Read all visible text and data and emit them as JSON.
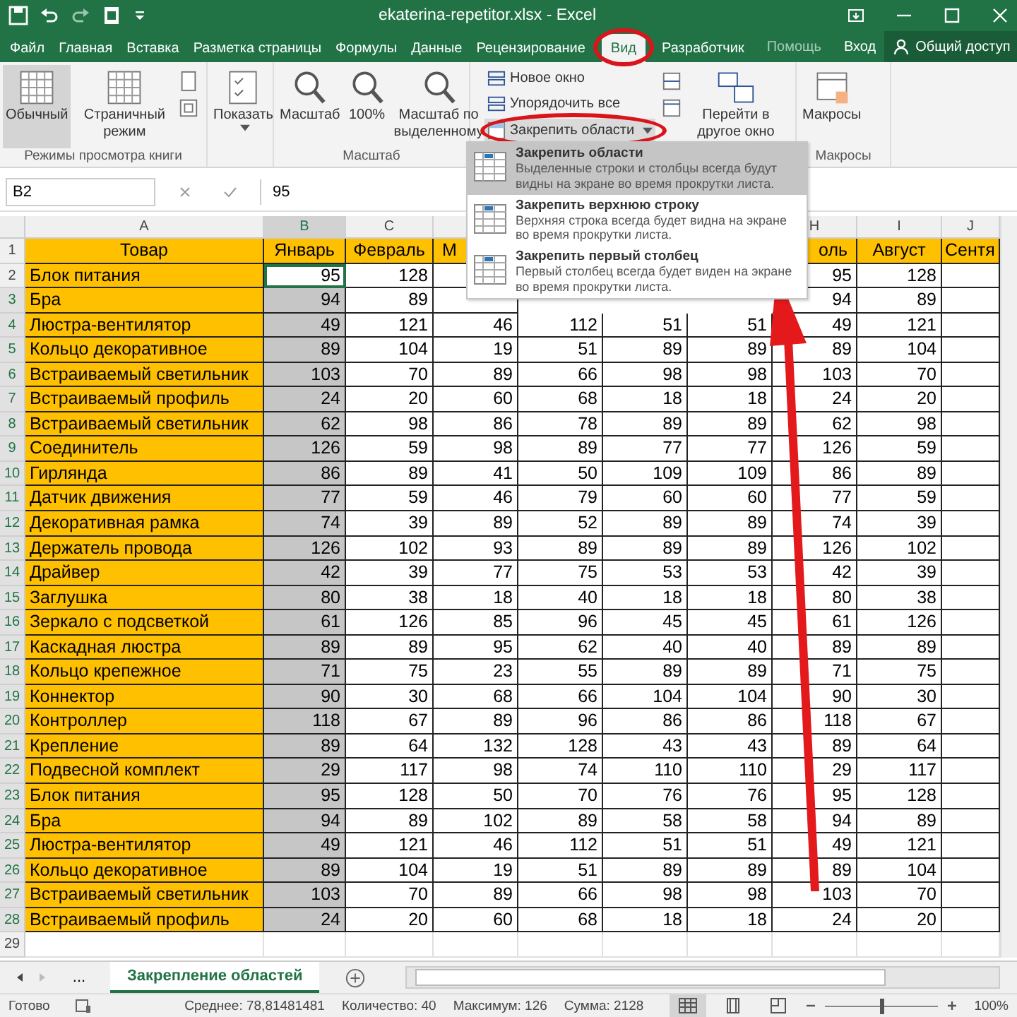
{
  "window": {
    "title": "ekaterina-repetitor.xlsx - Excel"
  },
  "tabs": [
    {
      "label": "Файл",
      "selected": false
    },
    {
      "label": "Главная",
      "selected": false
    },
    {
      "label": "Вставка",
      "selected": false
    },
    {
      "label": "Разметка страницы",
      "selected": false
    },
    {
      "label": "Формулы",
      "selected": false
    },
    {
      "label": "Данные",
      "selected": false
    },
    {
      "label": "Рецензирование",
      "selected": false
    },
    {
      "label": "Вид",
      "selected": true
    },
    {
      "label": "Разработчик",
      "selected": false
    }
  ],
  "help": "Помощь",
  "sign_in": "Вход",
  "share": "Общий доступ",
  "ribbon": {
    "views": {
      "label": "Режимы просмотра книги",
      "buttons": [
        {
          "label": "Обычный",
          "selected": true
        },
        {
          "label": "Страничный режим",
          "selected": false
        }
      ]
    },
    "show": "Показать",
    "zoom": {
      "label": "Масштаб",
      "buttons": [
        "Масштаб",
        "100%",
        "Масштаб по выделенному"
      ]
    },
    "window": {
      "commands": [
        "Новое окно",
        "Упорядочить все"
      ],
      "freeze": "Закрепить области",
      "switch": "Перейти в другое окно"
    },
    "macros": {
      "label": "Макросы",
      "button": "Макросы"
    }
  },
  "formula_bar": {
    "name_box": "B2",
    "value": "95"
  },
  "freeze_menu": [
    {
      "title": "Закрепить области",
      "description": "Выделенные строки и столбцы всегда будут видны на экране во время прокрутки листа.",
      "selected": true
    },
    {
      "title": "Закрепить верхнюю строку",
      "description": "Верхняя строка всегда будет видна на экране во время прокрутки листа.",
      "selected": false
    },
    {
      "title": "Закрепить первый столбец",
      "description": "Первый столбец всегда будет виден на экране во время прокрутки листа.",
      "selected": false
    }
  ],
  "sheet": {
    "column_letters": [
      "A",
      "B",
      "C",
      "H",
      "I",
      "J"
    ],
    "header_num": "1",
    "header": [
      "Товар",
      "Январь",
      "Февраль",
      "М",
      "оль",
      "Август",
      "Сентя"
    ],
    "rows": [
      {
        "num": "2",
        "label": "Блок питания",
        "selected": false,
        "values": [
          "95",
          "128",
          "95",
          "128"
        ]
      },
      {
        "num": "3",
        "label": "Бра",
        "selected": true,
        "values": [
          "94",
          "89",
          "94",
          "89"
        ]
      },
      {
        "num": "4",
        "label": "Люстра-вентилятор",
        "selected": true,
        "values": [
          "49",
          "121",
          "46",
          "112",
          "51",
          "51",
          "49",
          "121"
        ]
      },
      {
        "num": "5",
        "label": "Кольцо декоративное",
        "selected": true,
        "values": [
          "89",
          "104",
          "19",
          "51",
          "89",
          "89",
          "89",
          "104"
        ]
      },
      {
        "num": "6",
        "label": "Встраиваемый светильник",
        "selected": true,
        "values": [
          "103",
          "70",
          "89",
          "66",
          "98",
          "98",
          "103",
          "70"
        ]
      },
      {
        "num": "7",
        "label": "Встраиваемый профиль",
        "selected": true,
        "values": [
          "24",
          "20",
          "60",
          "68",
          "18",
          "18",
          "24",
          "20"
        ]
      },
      {
        "num": "8",
        "label": "Встраиваемый светильник",
        "selected": true,
        "values": [
          "62",
          "98",
          "86",
          "78",
          "89",
          "89",
          "62",
          "98"
        ]
      },
      {
        "num": "9",
        "label": "Соединитель",
        "selected": true,
        "values": [
          "126",
          "59",
          "98",
          "89",
          "77",
          "77",
          "126",
          "59"
        ]
      },
      {
        "num": "10",
        "label": "Гирлянда",
        "selected": true,
        "values": [
          "86",
          "89",
          "41",
          "50",
          "109",
          "109",
          "86",
          "89"
        ]
      },
      {
        "num": "11",
        "label": "Датчик движения",
        "selected": true,
        "values": [
          "77",
          "59",
          "46",
          "79",
          "60",
          "60",
          "77",
          "59"
        ]
      },
      {
        "num": "12",
        "label": "Декоративная рамка",
        "selected": true,
        "values": [
          "74",
          "39",
          "89",
          "52",
          "89",
          "89",
          "74",
          "39"
        ]
      },
      {
        "num": "13",
        "label": "Держатель провода",
        "selected": true,
        "values": [
          "126",
          "102",
          "93",
          "89",
          "89",
          "89",
          "126",
          "102"
        ]
      },
      {
        "num": "14",
        "label": "Драйвер",
        "selected": true,
        "values": [
          "42",
          "39",
          "77",
          "75",
          "53",
          "53",
          "42",
          "39"
        ]
      },
      {
        "num": "15",
        "label": "Заглушка",
        "selected": true,
        "values": [
          "80",
          "38",
          "18",
          "40",
          "18",
          "18",
          "80",
          "38"
        ]
      },
      {
        "num": "16",
        "label": "Зеркало с подсветкой",
        "selected": true,
        "values": [
          "61",
          "126",
          "85",
          "96",
          "45",
          "45",
          "61",
          "126"
        ]
      },
      {
        "num": "17",
        "label": "Каскадная люстра",
        "selected": true,
        "values": [
          "89",
          "89",
          "95",
          "62",
          "40",
          "40",
          "89",
          "89"
        ]
      },
      {
        "num": "18",
        "label": "Кольцо крепежное",
        "selected": true,
        "values": [
          "71",
          "75",
          "23",
          "55",
          "89",
          "89",
          "71",
          "75"
        ]
      },
      {
        "num": "19",
        "label": "Коннектор",
        "selected": true,
        "values": [
          "90",
          "30",
          "68",
          "66",
          "104",
          "104",
          "90",
          "30"
        ]
      },
      {
        "num": "20",
        "label": "Контроллер",
        "selected": true,
        "values": [
          "118",
          "67",
          "89",
          "96",
          "86",
          "86",
          "118",
          "67"
        ]
      },
      {
        "num": "21",
        "label": "Крепление",
        "selected": true,
        "values": [
          "89",
          "64",
          "132",
          "128",
          "43",
          "43",
          "89",
          "64"
        ]
      },
      {
        "num": "22",
        "label": "Подвесной комплект",
        "selected": true,
        "values": [
          "29",
          "117",
          "98",
          "74",
          "110",
          "110",
          "29",
          "117"
        ]
      },
      {
        "num": "23",
        "label": "Блок питания",
        "selected": true,
        "values": [
          "95",
          "128",
          "50",
          "70",
          "76",
          "76",
          "95",
          "128"
        ]
      },
      {
        "num": "24",
        "label": "Бра",
        "selected": true,
        "values": [
          "94",
          "89",
          "102",
          "89",
          "58",
          "58",
          "94",
          "89"
        ]
      },
      {
        "num": "25",
        "label": "Люстра-вентилятор",
        "selected": true,
        "values": [
          "49",
          "121",
          "46",
          "112",
          "51",
          "51",
          "49",
          "121"
        ]
      },
      {
        "num": "26",
        "label": "Кольцо декоративное",
        "selected": true,
        "values": [
          "89",
          "104",
          "19",
          "51",
          "89",
          "89",
          "89",
          "104"
        ]
      },
      {
        "num": "27",
        "label": "Встраиваемый светильник",
        "selected": true,
        "values": [
          "103",
          "70",
          "89",
          "66",
          "98",
          "98",
          "103",
          "70"
        ]
      },
      {
        "num": "28",
        "label": "Встраиваемый профиль",
        "selected": true,
        "values": [
          "24",
          "20",
          "60",
          "68",
          "18",
          "18",
          "24",
          "20"
        ]
      }
    ],
    "empty_rows": [
      {
        "num": "29"
      }
    ]
  },
  "sheet_tabs": {
    "more": "...",
    "tabs": [
      {
        "label": "Закрепление областей",
        "selected": true
      }
    ]
  },
  "status_bar": {
    "state": "Готово",
    "stats": [
      "Среднее: 78,81481481",
      "Количество: 40",
      "Максимум: 126",
      "Сумма: 2128"
    ],
    "zoom": "100%",
    "zoom_slider": {
      "level": 0.5
    }
  }
}
